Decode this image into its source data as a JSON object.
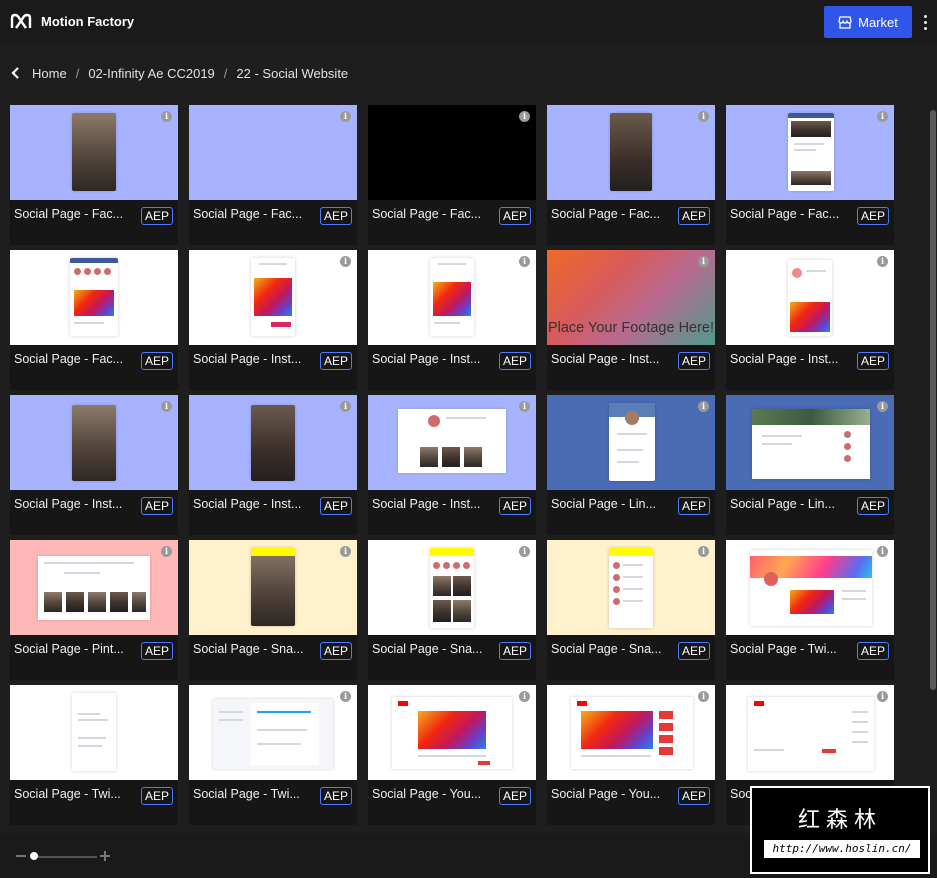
{
  "app": {
    "title": "Motion Factory"
  },
  "header": {
    "market_label": "Market"
  },
  "breadcrumb": {
    "items": [
      "Home",
      "02-Infinity Ae CC2019",
      "22 - Social Website"
    ]
  },
  "badge_label": "AEP",
  "placeholder_text": "Place Your Footage Here!",
  "cards": [
    {
      "label": "Social Page - Fac...",
      "bg": "#a8b3ff"
    },
    {
      "label": "Social Page - Fac...",
      "bg": "#a8b3ff"
    },
    {
      "label": "Social Page - Fac...",
      "bg": "#000000"
    },
    {
      "label": "Social Page - Fac...",
      "bg": "#a8b3ff"
    },
    {
      "label": "Social Page - Fac...",
      "bg": "#a8b3ff"
    },
    {
      "label": "Social Page - Fac...",
      "bg": "#ffffff"
    },
    {
      "label": "Social Page - Inst...",
      "bg": "#ffffff"
    },
    {
      "label": "Social Page - Inst...",
      "bg": "#ffffff"
    },
    {
      "label": "Social Page - Inst...",
      "bg": "gradient"
    },
    {
      "label": "Social Page - Inst...",
      "bg": "#ffffff"
    },
    {
      "label": "Social Page - Inst...",
      "bg": "#a8b3ff"
    },
    {
      "label": "Social Page - Inst...",
      "bg": "#a8b3ff"
    },
    {
      "label": "Social Page - Inst...",
      "bg": "#a8b3ff"
    },
    {
      "label": "Social Page - Lin...",
      "bg": "#4a6cb5"
    },
    {
      "label": "Social Page - Lin...",
      "bg": "#4a6cb5"
    },
    {
      "label": "Social Page - Pint...",
      "bg": "#ffb7b7"
    },
    {
      "label": "Social Page - Sna...",
      "bg": "#fff1cc"
    },
    {
      "label": "Social Page - Sna...",
      "bg": "#ffffff"
    },
    {
      "label": "Social Page - Sna...",
      "bg": "#fff1cc"
    },
    {
      "label": "Social Page - Twi...",
      "bg": "#ffffff"
    },
    {
      "label": "Social Page - Twi...",
      "bg": "#ffffff"
    },
    {
      "label": "Social Page - Twi...",
      "bg": "#ffffff"
    },
    {
      "label": "Social Page - You...",
      "bg": "#ffffff"
    },
    {
      "label": "Social Page - You...",
      "bg": "#ffffff"
    },
    {
      "label": "Social Page - You...",
      "bg": "#ffffff"
    }
  ],
  "watermark": {
    "title": "红森林",
    "url": "http://www.hoslin.cn/"
  },
  "colors": {
    "accent": "#2f56e8",
    "badge_border": "#4d7bff",
    "background": "#1e1e1e"
  },
  "icons": {
    "logo": "motion-factory-logo-icon",
    "market": "store-icon",
    "menu": "more-vertical-icon",
    "back": "chevron-left-icon",
    "info": "info-icon"
  }
}
